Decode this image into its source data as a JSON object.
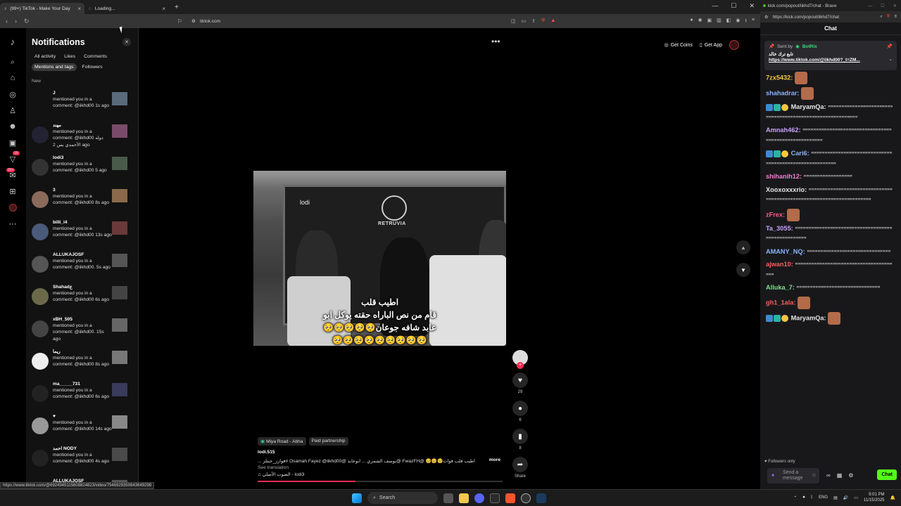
{
  "browser_left": {
    "tabs": [
      {
        "label": "(99+) TikTok - Make Your Day",
        "active": true
      },
      {
        "label": "Loading...",
        "active": false
      }
    ],
    "address": "tiktok.com",
    "status_url": "https://www.tiktok.com/@6924945115608824823/video/7546929350843649298"
  },
  "tiktok_sidebar": {
    "icons": [
      "tiktok-logo-icon",
      "search-icon",
      "home-icon",
      "explore-icon",
      "following-icon",
      "friends-icon",
      "live-icon",
      "activity-icon",
      "messages-icon",
      "upload-icon",
      "profile-icon",
      "more-icon"
    ],
    "activity_badge": "16",
    "messages_badge": "99+"
  },
  "notifications": {
    "title": "Notifications",
    "filters": [
      "All activity",
      "Likes",
      "Comments",
      "Mentions and tags",
      "Followers"
    ],
    "selected_filter": "Mentions and tags",
    "section_label": "New",
    "items": [
      {
        "name": "J",
        "text": "mentioned you in a comment: @iikhd00 1s ago"
      },
      {
        "name": "مهند",
        "text": "mentioned you in a comment: @iikhd00 دوله الأحمدي بس 2 ago"
      },
      {
        "name": "lodi3",
        "text": "mentioned you in a comment: @iikhd00 5 ago"
      },
      {
        "name": "3",
        "text": "mentioned you in a comment: @iikhd00 8s ago"
      },
      {
        "name": "billi_i4",
        "text": "mentioned you in a comment: @iikhd00 13s ago"
      },
      {
        "name": "ALLUKAJOSF",
        "text": "mentioned you in a comment: @iikhd00. 5s ago"
      },
      {
        "name": "Shahadع",
        "text": "mentioned you in a comment: @iikhd00 6s ago"
      },
      {
        "name": "xBH_505",
        "text": "mentioned you in a comment: @iikhd00. 15s ago"
      },
      {
        "name": "ريما",
        "text": "mentioned you in a comment: @iikhd00 8s ago"
      },
      {
        "name": "ma_____731",
        "text": "mentioned you in a comment: @iikhd00 6s ago"
      },
      {
        "name": "♥",
        "text": "mentioned you in a comment: @iikhd00 14s ago"
      },
      {
        "name": "احمد NODY",
        "text": "mentioned you in a comment: @iikhd00 4s ago"
      },
      {
        "name": "ALLUKAJOSF",
        "text": ""
      }
    ]
  },
  "feed": {
    "top_actions": {
      "coins": "Get Coins",
      "app": "Get App"
    },
    "video_overlay_name": "lodi",
    "video_brand": "RETRUVIA",
    "caption_line1": "اطيب قلب",
    "caption_line2": "قام من نص الباراه حقته يوكل ابو",
    "caption_line3": "عابد شافه جوعان🥺🥺🥺🥺🥺",
    "caption_line4": "🥺🥺🥺🥺🥺🥺🥺🥺🥺",
    "likes": "29",
    "comments": "6",
    "saves": "8",
    "share_label": "Share",
    "location_tag": "Miya Road - Abha",
    "partnership_tag": "Paid partnership",
    "author": "lodi.515",
    "description": "اطيب قلب قوات🥺🥺🥺 @FwazFH @يوسف الشمري ... ابوعابد @Osamah Fayez @iikhd00 #قوارز_جنتلز ...",
    "more_label": "more",
    "see_translation": "See translation",
    "sound": "♫ الصوت الأصلي - lodi3"
  },
  "chat_window": {
    "tab_label": "kick.com/popout/iikhd7/chat - Brave",
    "address": "https://kick.com/popout/iikhd7/chat",
    "header": "Chat",
    "pinned": {
      "sent_by": "Sent by",
      "bot": "BotRix",
      "arabic": "تابع ترك خالد",
      "link": "https://www.tiktok.com/@iikhd00?_t=ZM..."
    },
    "messages": [
      {
        "user": "7zx5432:",
        "color": "#f5c542",
        "text": "",
        "emote": true
      },
      {
        "user": "shahadrar:",
        "color": "#8ab4f8",
        "text": "",
        "emote": true
      },
      {
        "user": "MaryamQa:",
        "color": "#e6e6e6",
        "text": "ꟸꟸꟸꟸꟸꟸꟸꟸꟸꟸꟸꟸꟸꟸꟸꟸꟸꟸꟸꟸꟸꟸꟸꟸꟸꟸꟸꟸꟸꟸꟸꟸꟸꟸꟸꟸꟸꟸꟸꟸꟸꟸꟸꟸꟸꟸꟸꟸꟸꟸꟸꟸꟸꟸꟸꟸꟸꟸ",
        "badges": true
      },
      {
        "user": "Amnah462:",
        "color": "#c9a0ff",
        "text": "ꟸꟸꟸꟸꟸꟸꟸꟸꟸꟸꟸꟸꟸꟸꟸꟸꟸꟸꟸꟸꟸꟸꟸꟸꟸꟸꟸꟸꟸꟸꟸꟸꟸꟸꟸꟸꟸꟸꟸꟸꟸꟸꟸꟸꟸꟸꟸꟸꟸꟸꟸꟸꟸꟸ"
      },
      {
        "user": "Cari6:",
        "color": "#8ab4f8",
        "text": "ꟸꟸꟸꟸꟸꟸꟸꟸꟸꟸꟸꟸꟸꟸꟸꟸꟸꟸꟸꟸꟸꟸꟸꟸꟸꟸꟸꟸꟸꟸꟸꟸꟸꟸꟸꟸꟸꟸꟸꟸꟸꟸꟸꟸꟸꟸꟸꟸꟸꟸꟸꟸꟸꟸꟸꟸ",
        "badges": true
      },
      {
        "user": "shihanih12:",
        "color": "#f57ccf",
        "text": "ꟸꟸꟸꟸꟸꟸꟸꟸꟸꟸꟸꟸꟸꟸꟸꟸꟸꟸ"
      },
      {
        "user": "Xooxoxxxrio:",
        "color": "#e6e6e6",
        "text": "ꟸꟸꟸꟸꟸꟸꟸꟸꟸꟸꟸꟸꟸꟸꟸꟸꟸꟸꟸꟸꟸꟸꟸꟸꟸꟸꟸꟸꟸꟸꟸꟸꟸꟸꟸꟸꟸꟸꟸꟸꟸꟸꟸꟸꟸꟸꟸꟸꟸꟸꟸꟸꟸꟸꟸꟸꟸꟸꟸꟸꟸꟸꟸꟸꟸꟸꟸꟸꟸꟸ"
      },
      {
        "user": "zFrex:",
        "color": "#ff5c8a",
        "text": "",
        "emote": true
      },
      {
        "user": "Ta_3055:",
        "color": "#c9a0ff",
        "text": "ꟸꟸꟸꟸꟸꟸꟸꟸꟸꟸꟸꟸꟸꟸꟸꟸꟸꟸꟸꟸꟸꟸꟸꟸꟸꟸꟸꟸꟸꟸꟸꟸꟸꟸꟸꟸꟸꟸꟸꟸꟸꟸꟸꟸꟸꟸꟸꟸꟸꟸꟸ"
      },
      {
        "user": "AMANY_NQ:",
        "color": "#8ab4f8",
        "text": "ꟸꟸꟸꟸꟸꟸꟸꟸꟸꟸꟸꟸꟸꟸꟸꟸꟸꟸꟸꟸꟸꟸꟸꟸꟸꟸꟸꟸꟸꟸꟸ"
      },
      {
        "user": "ajwan10:",
        "color": "#ff5c5c",
        "text": "ꟸꟸꟸꟸꟸꟸꟸꟸꟸꟸꟸꟸꟸꟸꟸꟸꟸꟸꟸꟸꟸꟸꟸꟸꟸꟸꟸꟸꟸꟸꟸꟸꟸꟸꟸꟸꟸꟸꟸ"
      },
      {
        "user": "Alluka_7:",
        "color": "#7ee08a",
        "text": "ꟸꟸꟸꟸꟸꟸꟸꟸꟸꟸꟸꟸꟸꟸꟸꟸꟸꟸꟸꟸꟸꟸꟸꟸꟸꟸꟸꟸꟸꟸꟸ"
      },
      {
        "user": "gh1_1ala:",
        "color": "#ff5c5c",
        "text": "",
        "emote": true
      },
      {
        "user": "MaryamQa:",
        "color": "#e6e6e6",
        "text": "",
        "badges": true,
        "emote": true
      }
    ],
    "followers_only": "Followers only",
    "input_placeholder": "Send a message",
    "chat_button": "Chat"
  },
  "taskbar": {
    "search": "Search",
    "lang": "ENG",
    "time": "9:01 PM",
    "date": "11/15/2025"
  },
  "colors": {
    "kick_green": "#53fc18",
    "tiktok_red": "#fe2c55"
  }
}
